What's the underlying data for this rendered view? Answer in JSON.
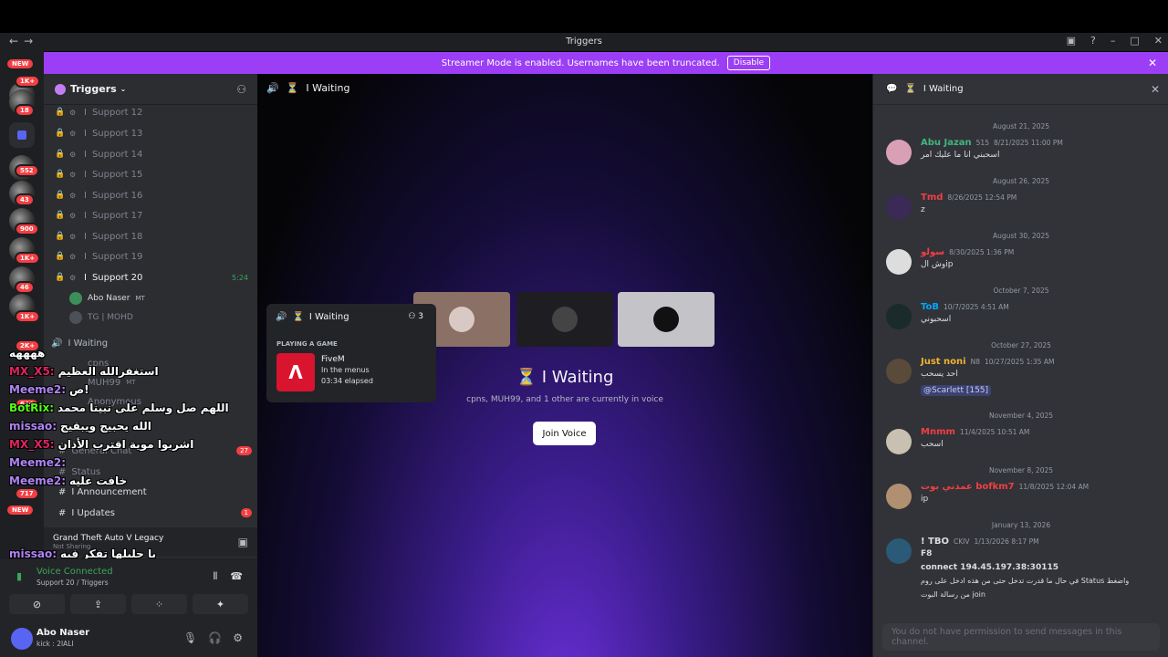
{
  "window": {
    "title": "Triggers",
    "back_label": "←",
    "forward_label": "→"
  },
  "banner": {
    "text": "Streamer Mode is enabled. Usernames have been truncated.",
    "disable_label": "Disable"
  },
  "servers": {
    "badges": [
      "1K+",
      "18",
      "552",
      "43",
      "900",
      "1K+",
      "46",
      "1K+",
      "2K+",
      "644",
      "717"
    ],
    "new_label": "NEW"
  },
  "sidebar": {
    "server_name": "Triggers",
    "channels": [
      {
        "name": "Support 12"
      },
      {
        "name": "Support 13"
      },
      {
        "name": "Support 14"
      },
      {
        "name": "Support 15"
      },
      {
        "name": "Support 16"
      },
      {
        "name": "Support 17"
      },
      {
        "name": "Support 18"
      },
      {
        "name": "Support 19"
      },
      {
        "name": "Support 20",
        "time": "5:24"
      }
    ],
    "voice_users": [
      {
        "name": "Abo Naser",
        "tag": "MT"
      },
      {
        "name": "TG | MOHD",
        "tag": ""
      }
    ],
    "lower_channels": [
      {
        "name": "I Waiting"
      },
      {
        "name": "cpns"
      },
      {
        "name": "MUH99",
        "tag": "MT"
      },
      {
        "name": "Anonymous"
      },
      {
        "name": "General Chat",
        "unread": "27"
      },
      {
        "name": "Status"
      },
      {
        "name": "I Announcement"
      },
      {
        "name": "I Updates",
        "unread": "1"
      }
    ]
  },
  "overlay_chat": [
    {
      "user": "ههههه",
      "text": "",
      "color": "#ffffff"
    },
    {
      "user": "MX_X5:",
      "text": "استغفرالله العظيم",
      "color": "#e0245e"
    },
    {
      "user": "Meeme2:",
      "text": "ص!",
      "color": "#b084f5"
    },
    {
      "user": "BotRix:",
      "text": "اللهم صل وسلم على نبينا محمد",
      "color": "#53fc18"
    },
    {
      "user": "missao:",
      "text": "الله يحبيج ويبقيج",
      "color": "#b084f5"
    },
    {
      "user": "MX_X5:",
      "text": "اشربوا موية اقترب الأذان",
      "color": "#e0245e"
    },
    {
      "user": "Meeme2:",
      "text": "",
      "color": "#b084f5"
    },
    {
      "user": "Meeme2:",
      "text": "خافت عليه",
      "color": "#b084f5"
    },
    {
      "user": "missao:",
      "text": "يا حليلها تفكر فيه",
      "color": "#b084f5"
    }
  ],
  "activity": {
    "game": "Grand Theft Auto V Legacy",
    "status": "Not Sharing"
  },
  "voice_panel": {
    "status": "Voice Connected",
    "location": "Support 20 / Triggers"
  },
  "user_panel": {
    "name": "Abo Naser",
    "status": "kick : 2IALI"
  },
  "main": {
    "channel_title": "I Waiting",
    "voice_title": "I Waiting",
    "voice_desc": "cpns, MUH99, and 1 other are currently in voice",
    "join_label": "Join Voice"
  },
  "popup": {
    "title": "I Waiting",
    "count": "3",
    "label": "PLAYING A GAME",
    "game": "FiveM",
    "state": "In the menus",
    "elapsed": "03:34 elapsed",
    "game_icon": "Λ"
  },
  "thread": {
    "title": "I Waiting",
    "no_permission": "You do not have permission to send messages in this channel.",
    "dates": [
      "August 21, 2025",
      "August 26, 2025",
      "August 30, 2025",
      "October 7, 2025",
      "October 27, 2025",
      "November 4, 2025",
      "November 8, 2025",
      "January 13, 2026"
    ],
    "messages": [
      {
        "name": "Abu Jazan",
        "badge": "515",
        "time": "8/21/2025 11:00 PM",
        "body": "اسحبني انا ما عليك امر",
        "color": "#43b581"
      },
      {
        "name": "Tmd",
        "badge": "",
        "time": "8/26/2025 12:54 PM",
        "body": "z",
        "color": "#f23f43"
      },
      {
        "name": "سولو",
        "badge": "",
        "time": "8/30/2025 1:36 PM",
        "body": "وش الip",
        "color": "#f23f43"
      },
      {
        "name": "ToB",
        "badge": "",
        "time": "10/7/2025 4:51 AM",
        "body": "اسحبوني",
        "color": "#00a8fc"
      },
      {
        "name": "Just noni",
        "badge": "N8",
        "time": "10/27/2025 1:35 AM",
        "body": "احد يسحب",
        "mention": "@Scarlett [155]",
        "color": "#f0b232"
      },
      {
        "name": "Mnmm",
        "badge": "",
        "time": "11/4/2025 10:51 AM",
        "body": "اسحب",
        "color": "#f23f43"
      },
      {
        "name": "عمدني بوت bofkm7",
        "badge": "",
        "time": "11/8/2025 12:04 AM",
        "body": "ip",
        "color": "#f23f43"
      },
      {
        "name": "! TBO",
        "badge": "CKIV",
        "time": "1/13/2026 8:17 PM",
        "body": "F8",
        "body2": "connect 194.45.197.38:30115",
        "body3": "في حال ما قدرت تدخل حتى من هذه ادخل على روم Status واضغط",
        "body4": "من رسالة البوت join",
        "color": "#dbdee1"
      }
    ]
  }
}
